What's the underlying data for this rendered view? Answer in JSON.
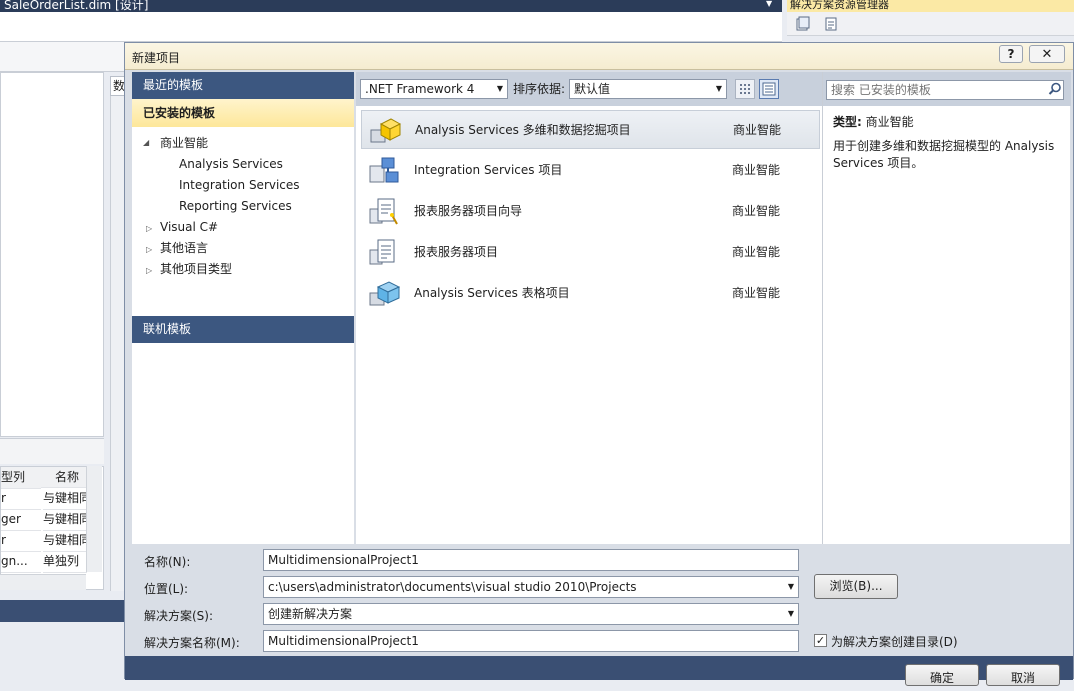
{
  "ide": {
    "title": "SaleOrderList.dim [设计]",
    "side_tab": "数",
    "grid": {
      "headers": [
        "型列",
        "名称"
      ],
      "rows": [
        [
          "r",
          "与键相同"
        ],
        [
          "ger",
          "与键相同"
        ],
        [
          "r",
          "与键相同"
        ],
        [
          "gn...",
          "单独列"
        ]
      ]
    },
    "solution_explorer_title": "解决方案资源管理器"
  },
  "dialog": {
    "title": "新建项目",
    "help_label": "?",
    "close_label": "✕",
    "nav": {
      "recent": "最近的模板",
      "installed": "已安装的模板",
      "tree": [
        {
          "label": "商业智能",
          "expanded": true,
          "children": [
            "Analysis Services",
            "Integration Services",
            "Reporting Services"
          ]
        },
        {
          "label": "Visual C#",
          "expanded": false
        },
        {
          "label": "其他语言",
          "expanded": false
        },
        {
          "label": "其他项目类型",
          "expanded": false
        }
      ],
      "online": "联机模板"
    },
    "toolbar": {
      "framework": ".NET Framework 4",
      "sort_label": "排序依据:",
      "sort_value": "默认值"
    },
    "templates": [
      {
        "name": "Analysis Services 多维和数据挖掘项目",
        "type": "商业智能",
        "selected": true,
        "icon": "cube-icon"
      },
      {
        "name": "Integration Services 项目",
        "type": "商业智能",
        "icon": "flow-icon"
      },
      {
        "name": "报表服务器项目向导",
        "type": "商业智能",
        "icon": "report-wizard-icon"
      },
      {
        "name": "报表服务器项目",
        "type": "商业智能",
        "icon": "report-icon"
      },
      {
        "name": "Analysis Services 表格项目",
        "type": "商业智能",
        "icon": "tabular-icon"
      }
    ],
    "search": {
      "placeholder": "搜索 已安装的模板"
    },
    "description": {
      "type_label": "类型:",
      "type_value": "商业智能",
      "text": "用于创建多维和数据挖掘模型的 Analysis Services 项目。"
    },
    "form": {
      "name_label": "名称(N):",
      "name_value": "MultidimensionalProject1",
      "location_label": "位置(L):",
      "location_value": "c:\\users\\administrator\\documents\\visual studio 2010\\Projects",
      "browse_label": "浏览(B)...",
      "solution_label": "解决方案(S):",
      "solution_value": "创建新解决方案",
      "solution_name_label": "解决方案名称(M):",
      "solution_name_value": "MultidimensionalProject1",
      "create_dir_label": "为解决方案创建目录(D)",
      "create_dir_checked": "✓"
    },
    "buttons": {
      "ok": "确定",
      "cancel": "取消"
    }
  }
}
